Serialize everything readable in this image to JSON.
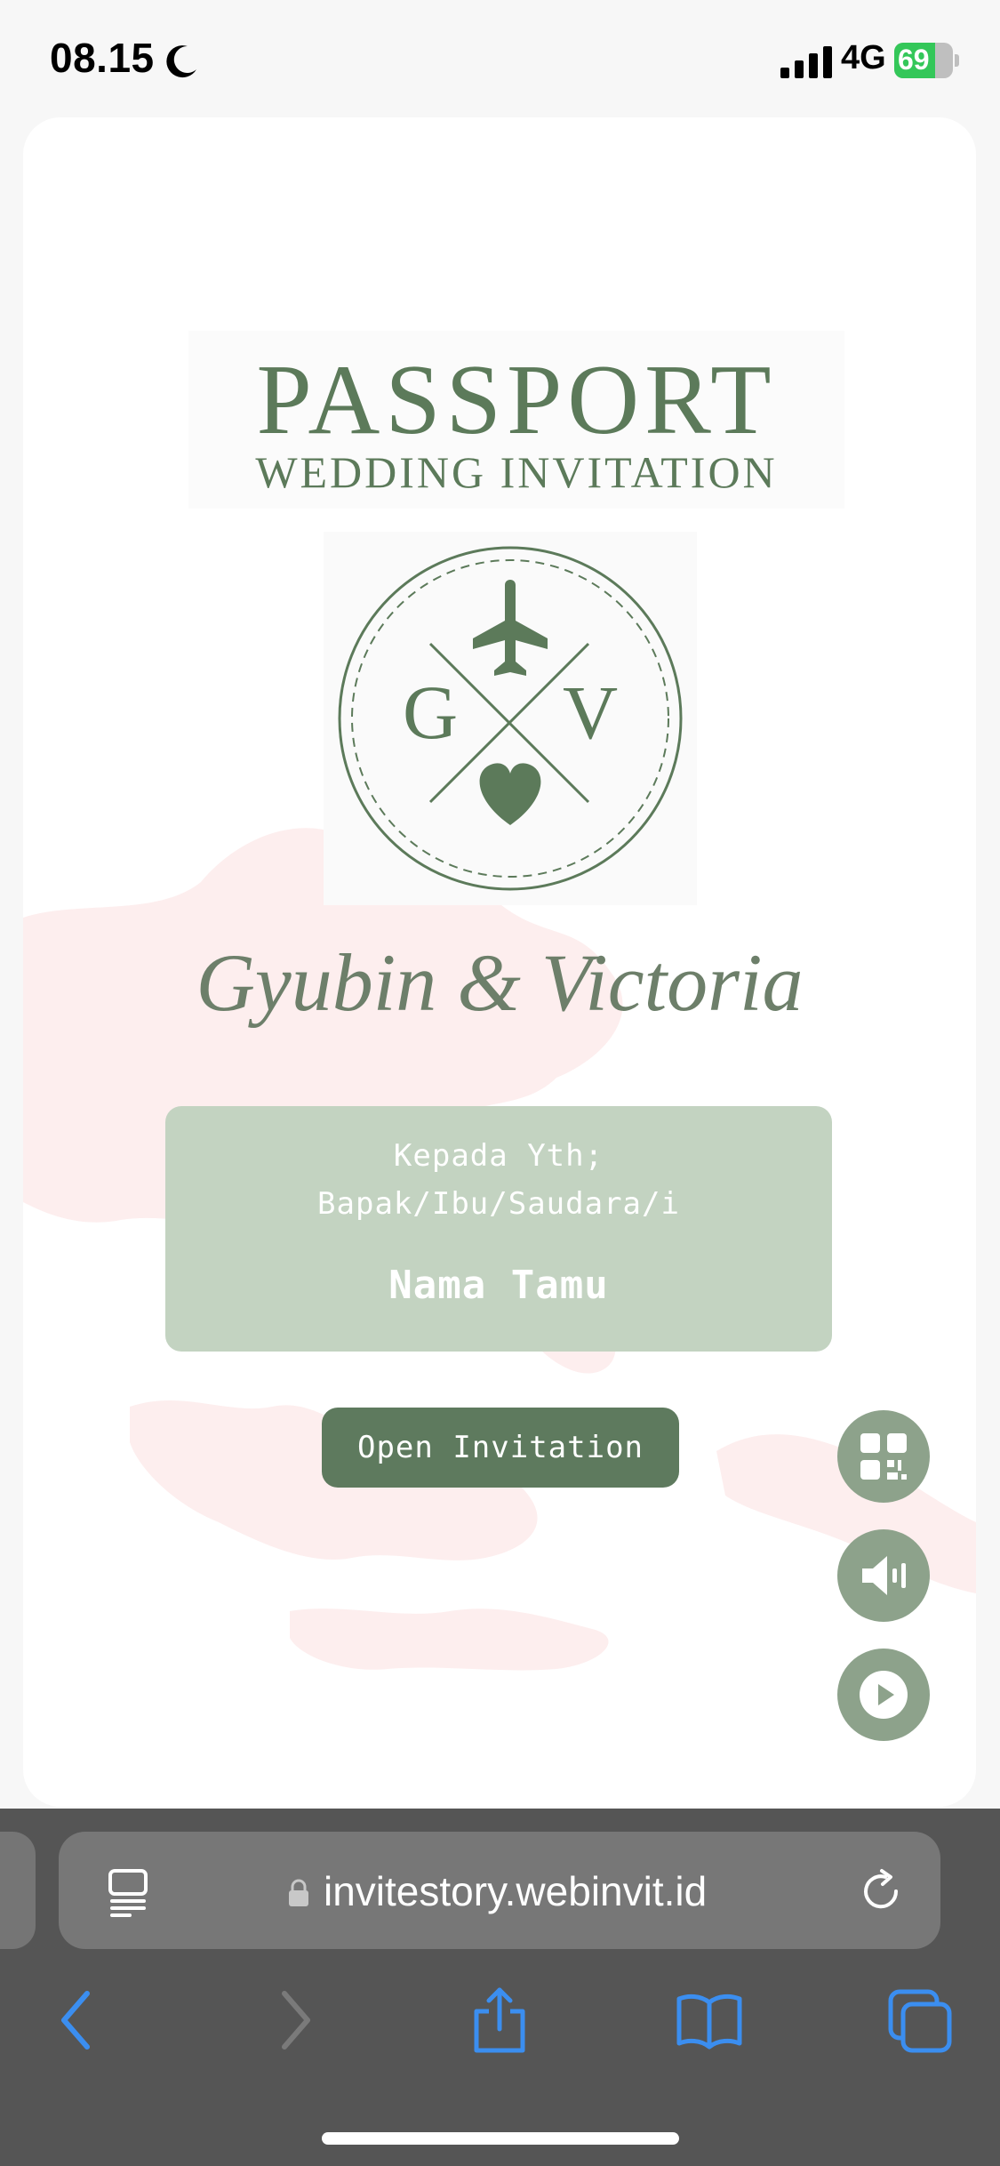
{
  "status_bar": {
    "time": "08.15",
    "network": "4G",
    "battery_level": "69",
    "battery_fraction": 0.69,
    "battery_color": "#34c759"
  },
  "invitation": {
    "title": "PASSPORT",
    "subtitle": "WEDDING INVITATION",
    "emblem": {
      "initial_left": "G",
      "initial_right": "V",
      "icons": [
        "airplane-icon",
        "heart-icon"
      ]
    },
    "couple_names": "Gyubin & Victoria",
    "guest": {
      "greeting": "Kepada Yth;",
      "salutation": "Bapak/Ibu/Saudara/i",
      "name": "Nama Tamu"
    },
    "open_button_label": "Open Invitation",
    "floating_buttons": [
      "qr-code-icon",
      "speaker-icon",
      "play-icon"
    ],
    "colors": {
      "primary_green": "#5e7a5e",
      "box_green": "#c3d3c1",
      "fab_green": "#8da28b",
      "map_tint": "#fdeeee"
    }
  },
  "browser": {
    "url": "invitestory.webinvit.id",
    "icons": [
      "reader-icon",
      "lock-icon",
      "reload-icon",
      "back-icon",
      "forward-icon",
      "share-icon",
      "bookmarks-icon",
      "tabs-icon"
    ],
    "accent": "#3b8ef0"
  }
}
